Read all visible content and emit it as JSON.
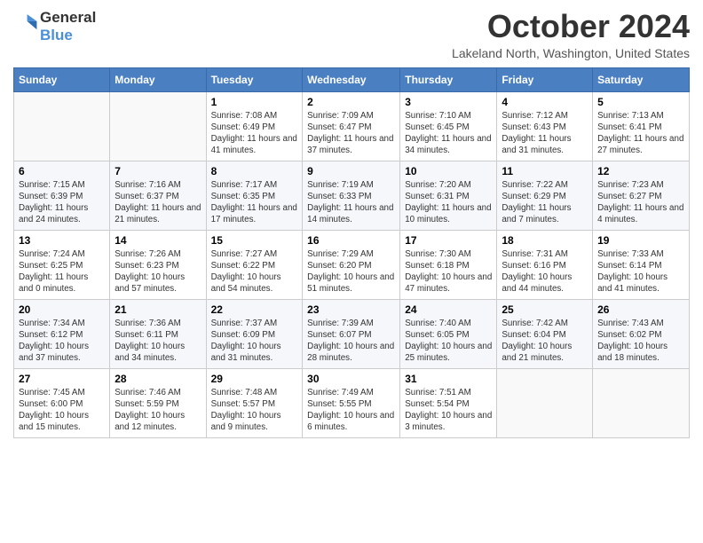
{
  "logo": {
    "line1": "General",
    "line2": "Blue",
    "icon_color": "#4a90d9"
  },
  "title": "October 2024",
  "location": "Lakeland North, Washington, United States",
  "days_of_week": [
    "Sunday",
    "Monday",
    "Tuesday",
    "Wednesday",
    "Thursday",
    "Friday",
    "Saturday"
  ],
  "weeks": [
    [
      {
        "day": "",
        "info": ""
      },
      {
        "day": "",
        "info": ""
      },
      {
        "day": "1",
        "info": "Sunrise: 7:08 AM\nSunset: 6:49 PM\nDaylight: 11 hours and 41 minutes."
      },
      {
        "day": "2",
        "info": "Sunrise: 7:09 AM\nSunset: 6:47 PM\nDaylight: 11 hours and 37 minutes."
      },
      {
        "day": "3",
        "info": "Sunrise: 7:10 AM\nSunset: 6:45 PM\nDaylight: 11 hours and 34 minutes."
      },
      {
        "day": "4",
        "info": "Sunrise: 7:12 AM\nSunset: 6:43 PM\nDaylight: 11 hours and 31 minutes."
      },
      {
        "day": "5",
        "info": "Sunrise: 7:13 AM\nSunset: 6:41 PM\nDaylight: 11 hours and 27 minutes."
      }
    ],
    [
      {
        "day": "6",
        "info": "Sunrise: 7:15 AM\nSunset: 6:39 PM\nDaylight: 11 hours and 24 minutes."
      },
      {
        "day": "7",
        "info": "Sunrise: 7:16 AM\nSunset: 6:37 PM\nDaylight: 11 hours and 21 minutes."
      },
      {
        "day": "8",
        "info": "Sunrise: 7:17 AM\nSunset: 6:35 PM\nDaylight: 11 hours and 17 minutes."
      },
      {
        "day": "9",
        "info": "Sunrise: 7:19 AM\nSunset: 6:33 PM\nDaylight: 11 hours and 14 minutes."
      },
      {
        "day": "10",
        "info": "Sunrise: 7:20 AM\nSunset: 6:31 PM\nDaylight: 11 hours and 10 minutes."
      },
      {
        "day": "11",
        "info": "Sunrise: 7:22 AM\nSunset: 6:29 PM\nDaylight: 11 hours and 7 minutes."
      },
      {
        "day": "12",
        "info": "Sunrise: 7:23 AM\nSunset: 6:27 PM\nDaylight: 11 hours and 4 minutes."
      }
    ],
    [
      {
        "day": "13",
        "info": "Sunrise: 7:24 AM\nSunset: 6:25 PM\nDaylight: 11 hours and 0 minutes."
      },
      {
        "day": "14",
        "info": "Sunrise: 7:26 AM\nSunset: 6:23 PM\nDaylight: 10 hours and 57 minutes."
      },
      {
        "day": "15",
        "info": "Sunrise: 7:27 AM\nSunset: 6:22 PM\nDaylight: 10 hours and 54 minutes."
      },
      {
        "day": "16",
        "info": "Sunrise: 7:29 AM\nSunset: 6:20 PM\nDaylight: 10 hours and 51 minutes."
      },
      {
        "day": "17",
        "info": "Sunrise: 7:30 AM\nSunset: 6:18 PM\nDaylight: 10 hours and 47 minutes."
      },
      {
        "day": "18",
        "info": "Sunrise: 7:31 AM\nSunset: 6:16 PM\nDaylight: 10 hours and 44 minutes."
      },
      {
        "day": "19",
        "info": "Sunrise: 7:33 AM\nSunset: 6:14 PM\nDaylight: 10 hours and 41 minutes."
      }
    ],
    [
      {
        "day": "20",
        "info": "Sunrise: 7:34 AM\nSunset: 6:12 PM\nDaylight: 10 hours and 37 minutes."
      },
      {
        "day": "21",
        "info": "Sunrise: 7:36 AM\nSunset: 6:11 PM\nDaylight: 10 hours and 34 minutes."
      },
      {
        "day": "22",
        "info": "Sunrise: 7:37 AM\nSunset: 6:09 PM\nDaylight: 10 hours and 31 minutes."
      },
      {
        "day": "23",
        "info": "Sunrise: 7:39 AM\nSunset: 6:07 PM\nDaylight: 10 hours and 28 minutes."
      },
      {
        "day": "24",
        "info": "Sunrise: 7:40 AM\nSunset: 6:05 PM\nDaylight: 10 hours and 25 minutes."
      },
      {
        "day": "25",
        "info": "Sunrise: 7:42 AM\nSunset: 6:04 PM\nDaylight: 10 hours and 21 minutes."
      },
      {
        "day": "26",
        "info": "Sunrise: 7:43 AM\nSunset: 6:02 PM\nDaylight: 10 hours and 18 minutes."
      }
    ],
    [
      {
        "day": "27",
        "info": "Sunrise: 7:45 AM\nSunset: 6:00 PM\nDaylight: 10 hours and 15 minutes."
      },
      {
        "day": "28",
        "info": "Sunrise: 7:46 AM\nSunset: 5:59 PM\nDaylight: 10 hours and 12 minutes."
      },
      {
        "day": "29",
        "info": "Sunrise: 7:48 AM\nSunset: 5:57 PM\nDaylight: 10 hours and 9 minutes."
      },
      {
        "day": "30",
        "info": "Sunrise: 7:49 AM\nSunset: 5:55 PM\nDaylight: 10 hours and 6 minutes."
      },
      {
        "day": "31",
        "info": "Sunrise: 7:51 AM\nSunset: 5:54 PM\nDaylight: 10 hours and 3 minutes."
      },
      {
        "day": "",
        "info": ""
      },
      {
        "day": "",
        "info": ""
      }
    ]
  ]
}
